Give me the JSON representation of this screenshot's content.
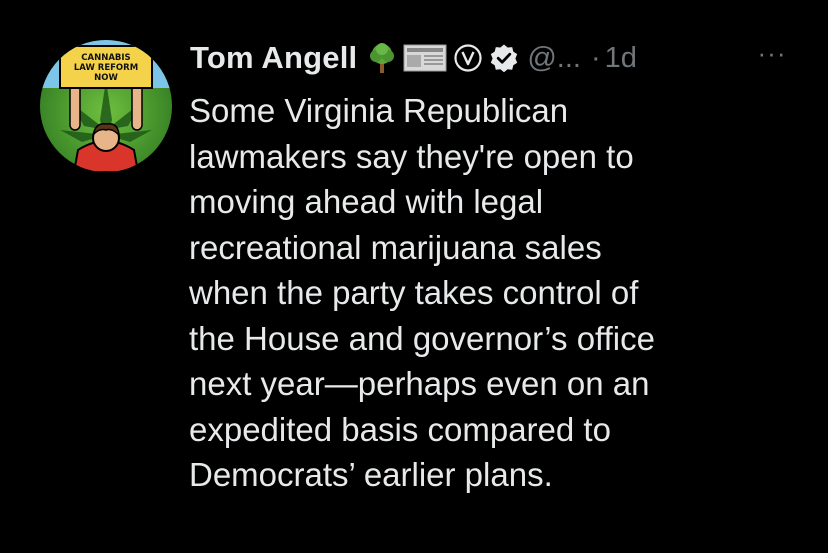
{
  "tweet": {
    "author": {
      "name": "Tom Angell",
      "handle": "@...",
      "badges": [
        "tree-icon",
        "newspaper-icon",
        "v-circle-icon",
        "verified-check-icon"
      ],
      "avatar_sign_text": [
        "CANNABIS",
        "LAW REFORM",
        "NOW"
      ]
    },
    "separator": "·",
    "timestamp": "1d",
    "more_label": "···",
    "text_lines": [
      "Some Virginia Republican",
      "lawmakers say they're open to",
      "moving ahead with legal",
      "recreational marijuana sales",
      "when the party takes control of",
      "the House and governor’s office",
      "next year—perhaps even on an",
      "expedited basis compared to",
      "Democrats’ earlier plans."
    ]
  },
  "colors": {
    "background": "#000000",
    "text_primary": "#e7e9ea",
    "text_secondary": "#71767b"
  }
}
